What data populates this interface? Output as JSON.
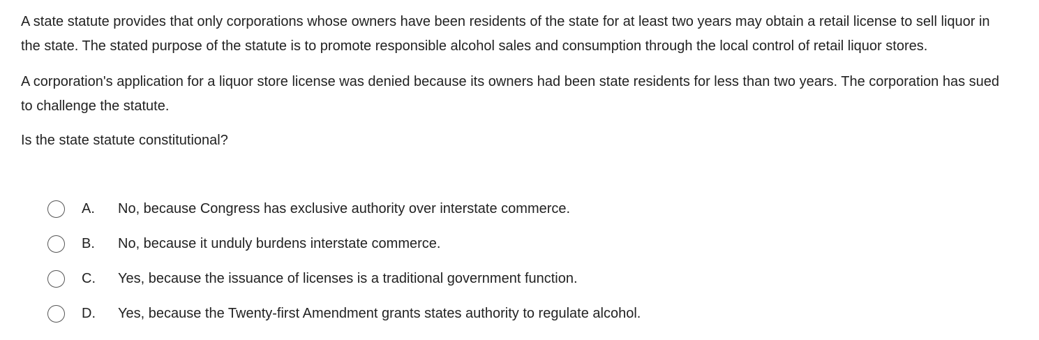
{
  "question": {
    "paragraphs": [
      "A state statute provides that only corporations whose owners have been residents of the state for at least two years may obtain a retail license to sell liquor in the state.  The stated purpose of the statute is to promote responsible alcohol sales and consumption through the local control of retail liquor stores.",
      "A corporation's application for a liquor store license was denied because its owners had been state residents for less than two years.  The corporation has sued to challenge the statute.",
      "Is the state statute constitutional?"
    ],
    "options": [
      {
        "letter": "A.",
        "text": "No, because Congress has exclusive authority over interstate commerce."
      },
      {
        "letter": "B.",
        "text": "No, because it unduly burdens interstate commerce."
      },
      {
        "letter": "C.",
        "text": "Yes, because the issuance of licenses is a traditional government function."
      },
      {
        "letter": "D.",
        "text": "Yes, because the Twenty-first Amendment grants states authority to regulate alcohol."
      }
    ],
    "selected": null
  },
  "colors": {
    "text": "#222222",
    "radio_border": "#555555",
    "background": "#ffffff"
  }
}
